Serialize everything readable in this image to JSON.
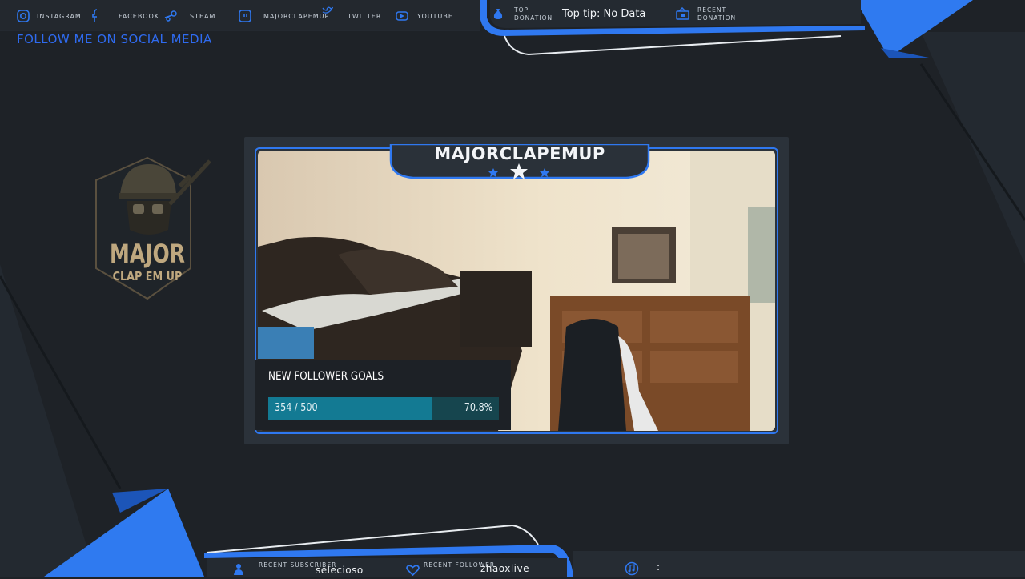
{
  "social": {
    "items": [
      {
        "label": "instagram",
        "icon": "instagram-icon"
      },
      {
        "label": "facebook",
        "icon": "facebook-icon"
      },
      {
        "label": "steam",
        "icon": "steam-icon"
      },
      {
        "label": "majorclapemup",
        "icon": "twitch-icon"
      },
      {
        "label": "twitter",
        "icon": "twitter-icon"
      },
      {
        "label": "youtube",
        "icon": "youtube-icon"
      }
    ],
    "follow_title": "FOLLOW ME ON SOCIAL MEDIA"
  },
  "donations": {
    "top_label": "TOP DONATION",
    "top_value": "Top tip: No Data",
    "recent_label": "RECENT DONATION",
    "recent_value": ""
  },
  "logo": {
    "line1": "MAJOR",
    "line2": "CLAP EM UP"
  },
  "stream": {
    "name": "MAJORCLAPEMUP"
  },
  "goal": {
    "title": "NEW FOLLOWER GOALS",
    "count_text": "354 / 500",
    "percent_text": "70.8%",
    "progress": 0.708
  },
  "bottom": {
    "subscriber_label": "RECENT SUBSCRIBER",
    "subscriber_value": "selecioso",
    "follower_label": "RECENT FOLLOWER",
    "follower_value": "zhaoxlive",
    "music_value": ":"
  },
  "colors": {
    "accent": "#2f78f0",
    "background": "#1e2227",
    "goal_fill": "#137a93",
    "goal_track": "#16454e",
    "logo_gold": "#bfa87f"
  }
}
